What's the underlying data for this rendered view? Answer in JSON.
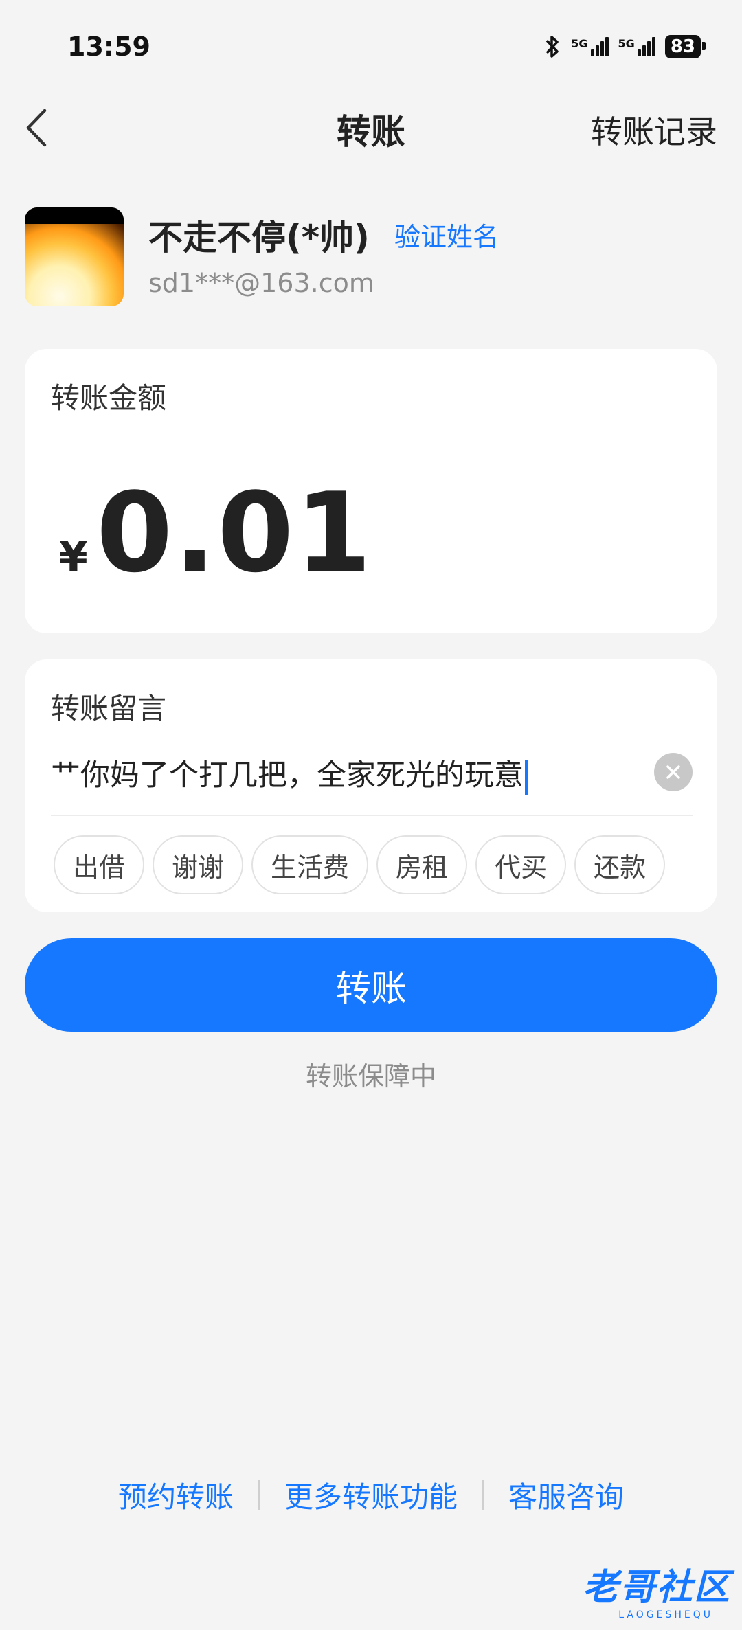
{
  "status_bar": {
    "time": "13:59",
    "battery": "83",
    "network_1": "5G",
    "network_2": "5G"
  },
  "header": {
    "title": "转账",
    "history_link": "转账记录"
  },
  "recipient": {
    "name": "不走不停(*帅)",
    "verify_label": "验证姓名",
    "account": "sd1***@163.com"
  },
  "amount": {
    "label": "转账金额",
    "currency": "¥",
    "value": "0.01"
  },
  "message": {
    "label": "转账留言",
    "value": "艹你妈了个打几把，全家死光的玩意",
    "quick_chips": [
      "出借",
      "谢谢",
      "生活费",
      "房租",
      "代买",
      "还款"
    ]
  },
  "submit_label": "转账",
  "protection_text": "转账保障中",
  "footer_links": [
    "预约转账",
    "更多转账功能",
    "客服咨询"
  ],
  "watermark": {
    "main": "老哥社区",
    "sub": "LAOGESHEQU"
  },
  "colors": {
    "accent": "#1677ff",
    "background": "#f4f4f4",
    "card": "#ffffff"
  }
}
